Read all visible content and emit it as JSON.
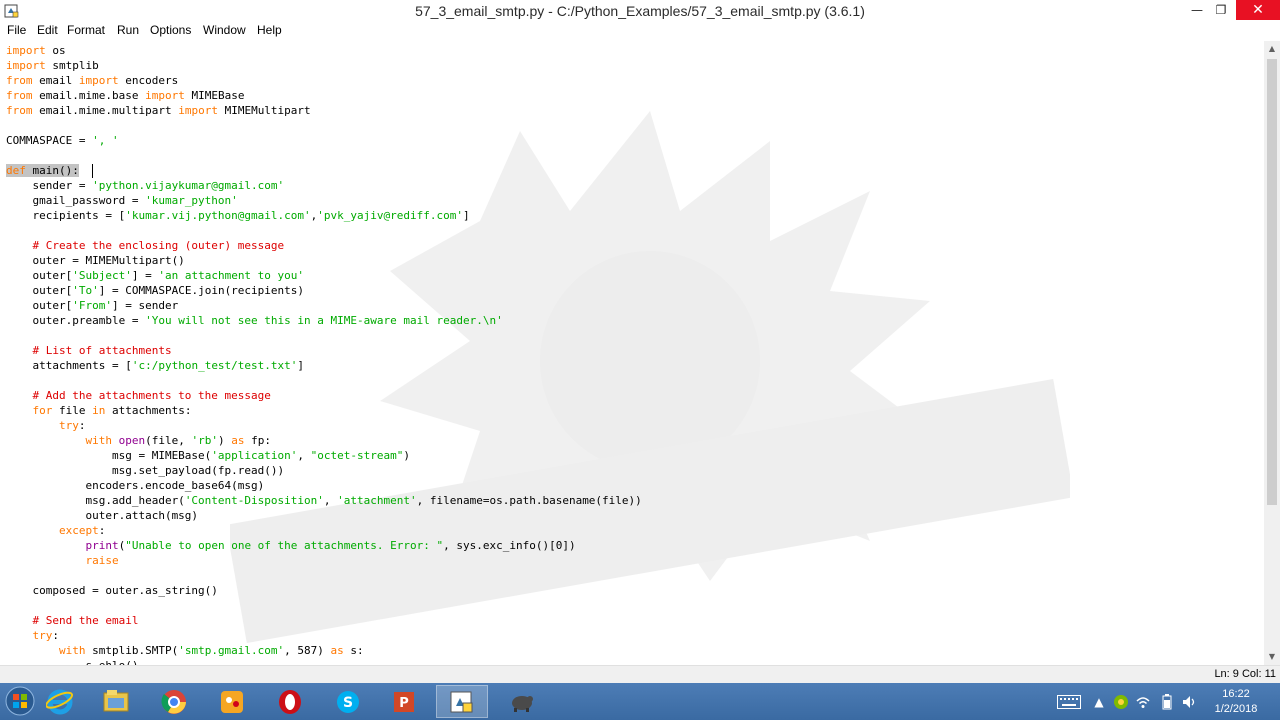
{
  "window": {
    "title": "57_3_email_smtp.py - C:/Python_Examples/57_3_email_smtp.py (3.6.1)",
    "minimize": "—",
    "maximize": "❐",
    "close": "✕"
  },
  "menu": {
    "items": [
      "File",
      "Edit",
      "Format",
      "Run",
      "Options",
      "Window",
      "Help"
    ]
  },
  "editor": {
    "lines": [
      "import os",
      "import smtplib",
      "from email import encoders",
      "from email.mime.base import MIMEBase",
      "from email.mime.multipart import MIMEMultipart",
      "",
      "COMMASPACE = ', '",
      "",
      "def main():",
      "    sender = 'python.vijaykumar@gmail.com'",
      "    gmail_password = 'kumar_python'",
      "    recipients = ['kumar.vij.python@gmail.com','pvk_yajiv@rediff.com']",
      "",
      "    # Create the enclosing (outer) message",
      "    outer = MIMEMultipart()",
      "    outer['Subject'] = 'an attachment to you'",
      "    outer['To'] = COMMASPACE.join(recipients)",
      "    outer['From'] = sender",
      "    outer.preamble = 'You will not see this in a MIME-aware mail reader.\\n'",
      "",
      "    # List of attachments",
      "    attachments = ['c:/python_test/test.txt']",
      "",
      "    # Add the attachments to the message",
      "    for file in attachments:",
      "        try:",
      "            with open(file, 'rb') as fp:",
      "                msg = MIMEBase('application', \"octet-stream\")",
      "                msg.set_payload(fp.read())",
      "            encoders.encode_base64(msg)",
      "            msg.add_header('Content-Disposition', 'attachment', filename=os.path.basename(file))",
      "            outer.attach(msg)",
      "        except:",
      "            print(\"Unable to open one of the attachments. Error: \", sys.exc_info()[0])",
      "            raise",
      "",
      "    composed = outer.as_string()",
      "",
      "    # Send the email",
      "    try:",
      "        with smtplib.SMTP('smtp.gmail.com', 587) as s:",
      "            s.ehlo()"
    ],
    "selected_text": "def main():"
  },
  "status": {
    "position": "Ln: 9   Col: 11"
  },
  "taskbar": {
    "clock_time": "16:22",
    "clock_date": "1/2/2018",
    "icons": [
      "internet-explorer-icon",
      "file-explorer-icon",
      "chrome-icon",
      "paint-icon",
      "opera-icon",
      "skype-icon",
      "powerpoint-icon",
      "python-idle-icon",
      "python-turtle-icon"
    ]
  },
  "colors": {
    "keyword": "#ff7700",
    "string": "#00aa00",
    "comment": "#dd0000",
    "builtin": "#900090",
    "selection": "#c3c3c3",
    "taskbar": "#3a6aa2",
    "close_button": "#e81123"
  }
}
